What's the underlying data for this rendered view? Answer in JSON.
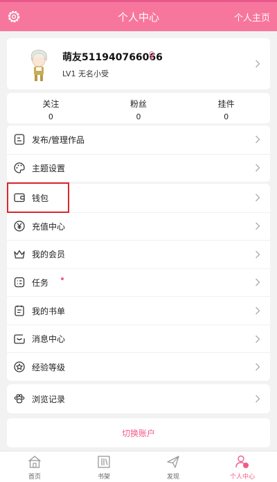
{
  "colors": {
    "accent": "#f7769d",
    "accent_text": "#f25b88",
    "highlight": "#d9262b"
  },
  "header": {
    "title": "个人中心",
    "home_link": "个人主页",
    "settings_icon": "gear-icon"
  },
  "profile": {
    "nickname": "萌友511940766066",
    "level": "LV1 无名小受",
    "gender_icon": "female-icon"
  },
  "stats": [
    {
      "label": "关注",
      "value": "0"
    },
    {
      "label": "粉丝",
      "value": "0"
    },
    {
      "label": "挂件",
      "value": "0"
    }
  ],
  "menu": {
    "group1": [
      {
        "label": "发布/管理作品",
        "icon": "publish-icon"
      },
      {
        "label": "主题设置",
        "icon": "palette-icon"
      }
    ],
    "group2": [
      {
        "label": "钱包",
        "icon": "wallet-icon"
      },
      {
        "label": "充值中心",
        "icon": "yen-icon"
      },
      {
        "label": "我的会员",
        "icon": "crown-icon"
      },
      {
        "label": "任务",
        "icon": "task-icon",
        "badge": "dot"
      },
      {
        "label": "我的书单",
        "icon": "booklist-icon"
      },
      {
        "label": "消息中心",
        "icon": "message-icon"
      },
      {
        "label": "经验等级",
        "icon": "star-badge-icon"
      }
    ],
    "group3": [
      {
        "label": "浏览记录",
        "icon": "paw-icon"
      }
    ]
  },
  "logout": {
    "label": "切换账户"
  },
  "tabbar": [
    {
      "label": "首页",
      "icon": "home-icon"
    },
    {
      "label": "书架",
      "icon": "bookshelf-icon"
    },
    {
      "label": "发现",
      "icon": "discover-icon"
    },
    {
      "label": "个人中心",
      "icon": "profile-icon",
      "active": true
    }
  ]
}
